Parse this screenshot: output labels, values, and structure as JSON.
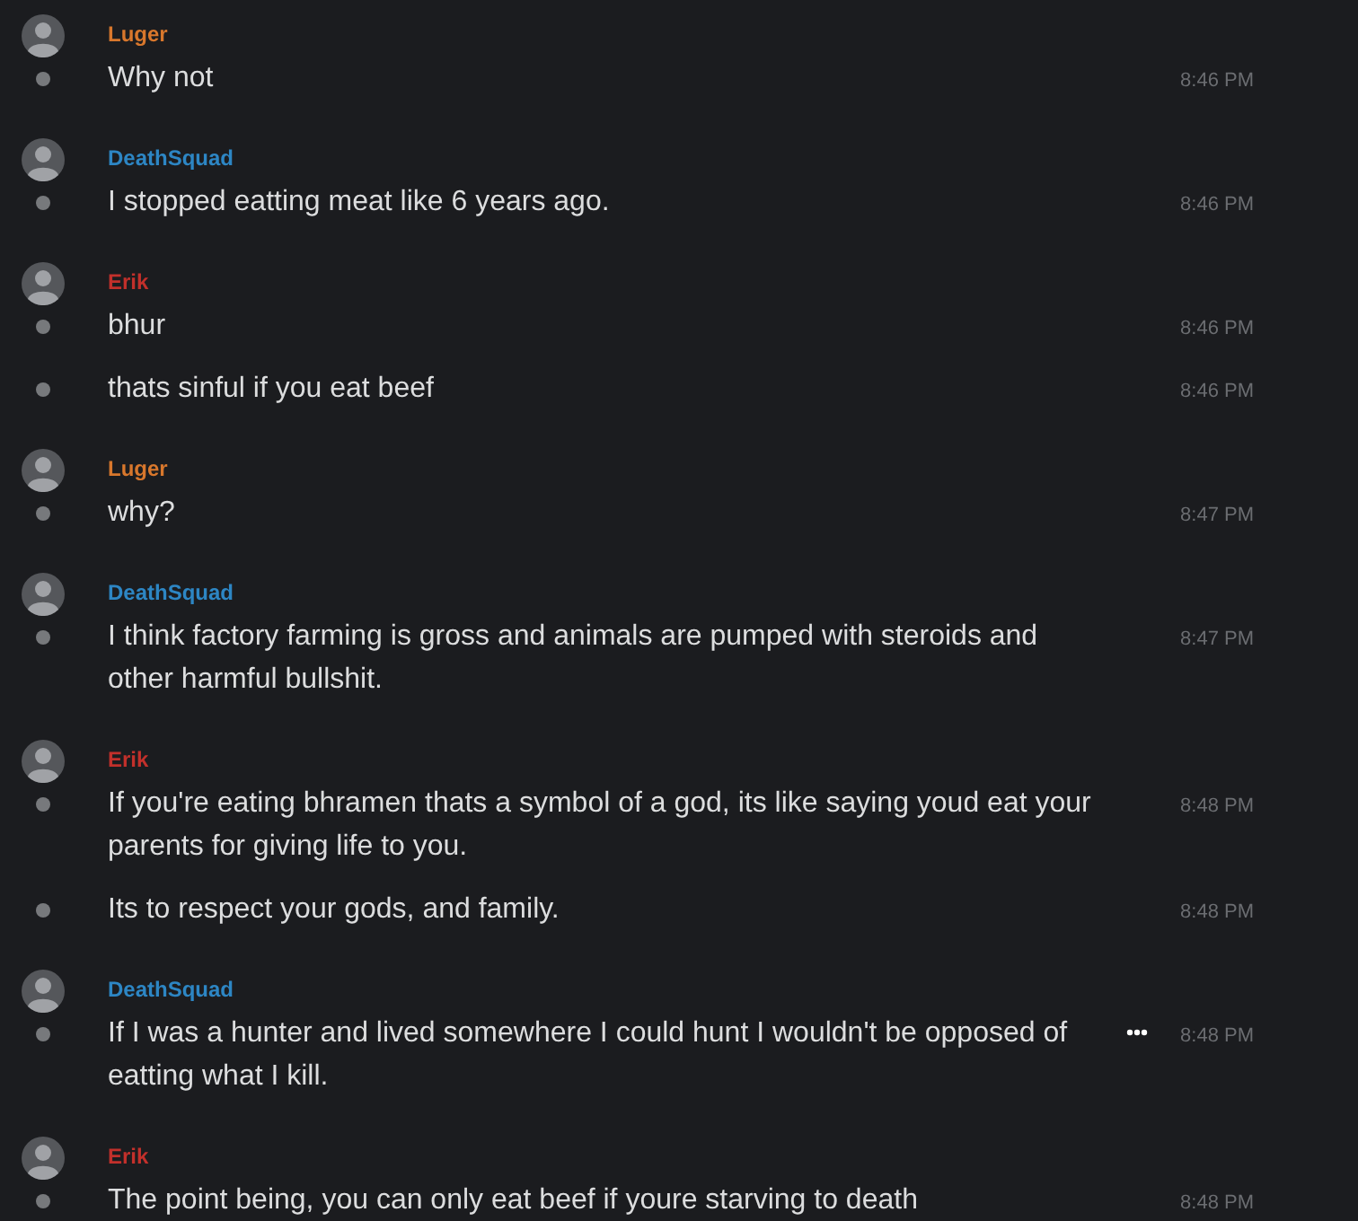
{
  "messages": [
    {
      "author": "Luger",
      "color": "#d8772c",
      "items": [
        {
          "text": "Why not",
          "time": "8:46 PM",
          "actions_shown": false
        }
      ]
    },
    {
      "author": "DeathSquad",
      "color": "#2d86c4",
      "items": [
        {
          "text": "I stopped eatting meat like 6 years ago.",
          "time": "8:46 PM",
          "actions_shown": false
        }
      ]
    },
    {
      "author": "Erik",
      "color": "#c2302b",
      "items": [
        {
          "text": "bhur",
          "time": "8:46 PM",
          "actions_shown": false
        },
        {
          "text": "thats sinful if you eat beef",
          "time": "8:46 PM",
          "actions_shown": false
        }
      ]
    },
    {
      "author": "Luger",
      "color": "#d8772c",
      "items": [
        {
          "text": "why?",
          "time": "8:47 PM",
          "actions_shown": false
        }
      ]
    },
    {
      "author": "DeathSquad",
      "color": "#2d86c4",
      "items": [
        {
          "text": "I think factory farming is gross and animals are pumped with steroids and other harmful bullshit.",
          "time": "8:47 PM",
          "actions_shown": false
        }
      ]
    },
    {
      "author": "Erik",
      "color": "#c2302b",
      "items": [
        {
          "text": "If you're eating bhramen thats a symbol of a god, its like saying youd eat your parents for giving life to you.",
          "time": "8:48 PM",
          "actions_shown": false
        },
        {
          "text": "Its to respect your gods, and family.",
          "time": "8:48 PM",
          "actions_shown": false
        }
      ]
    },
    {
      "author": "DeathSquad",
      "color": "#2d86c4",
      "items": [
        {
          "text": "If I was a hunter and lived somewhere I could hunt I wouldn't be opposed of eatting what I kill.",
          "time": "8:48 PM",
          "actions_shown": true
        }
      ]
    },
    {
      "author": "Erik",
      "color": "#c2302b",
      "items": [
        {
          "text": "The point being, you can only eat beef if youre starving to death",
          "time": "8:48 PM",
          "actions_shown": false
        }
      ]
    }
  ]
}
